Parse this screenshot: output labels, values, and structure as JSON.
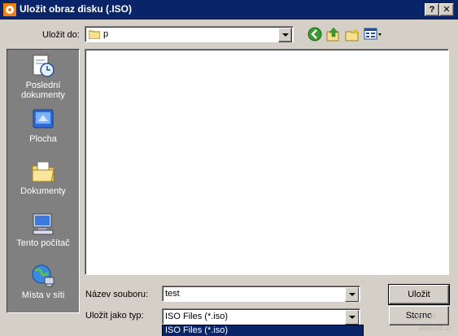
{
  "window": {
    "title": "Uložit obraz disku (.ISO)",
    "help_label": "?",
    "close_label": "✕"
  },
  "toolbar": {
    "save_in_label": "Uložit do:",
    "location_value": "p"
  },
  "places": [
    {
      "label_line1": "Poslední",
      "label_line2": "dokumenty"
    },
    {
      "label_line1": "Plocha",
      "label_line2": ""
    },
    {
      "label_line1": "Dokumenty",
      "label_line2": ""
    },
    {
      "label_line1": "Tento počítač",
      "label_line2": ""
    },
    {
      "label_line1": "Místa v síti",
      "label_line2": ""
    }
  ],
  "form": {
    "filename_label": "Název souboru:",
    "filename_value": "test",
    "filetype_label": "Uložit jako typ:",
    "filetype_value": "ISO Files (*.iso)",
    "filetype_option_highlighted": "ISO Files (*.iso)"
  },
  "buttons": {
    "save_label": "Uložit",
    "cancel_label": "Storno"
  },
  "watermark": {
    "line1": "CD - R",
    "line2": "www.cdr.cz"
  },
  "colors": {
    "titlebar": "#0a246a",
    "face": "#d4d0c8",
    "places_bg": "#808080"
  },
  "icons": [
    "app-icon",
    "folder-icon",
    "back-icon",
    "up-folder-icon",
    "new-folder-icon",
    "view-menu-icon",
    "recent-documents-icon",
    "desktop-icon",
    "my-documents-icon",
    "my-computer-icon",
    "network-places-icon",
    "help-icon",
    "close-icon"
  ]
}
